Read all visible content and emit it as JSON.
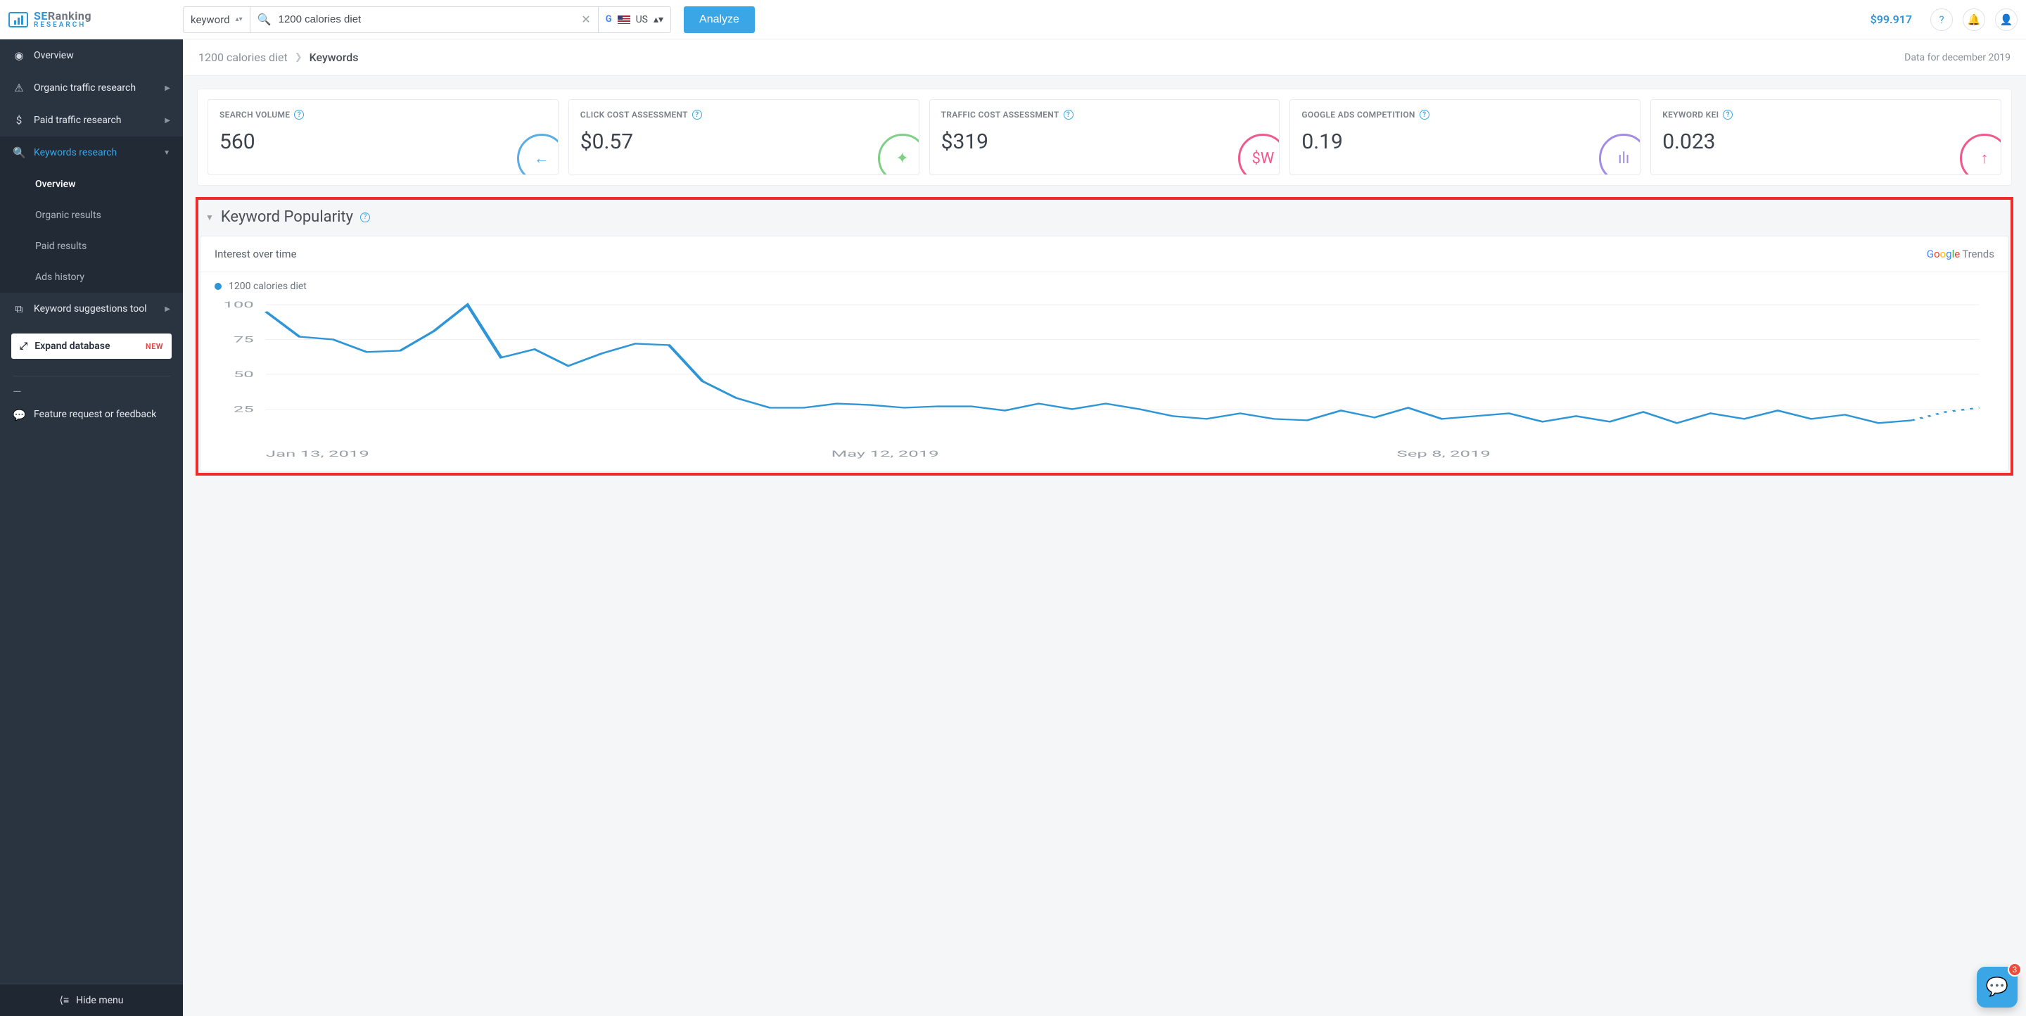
{
  "header": {
    "brand_se": "SE",
    "brand_ranking": "Ranking",
    "brand_sub": "RESEARCH",
    "mode_select": "keyword",
    "search_value": "1200 calories diet",
    "country_code": "US",
    "analyze_btn": "Analyze",
    "balance": "$99.917"
  },
  "sidebar": {
    "items": [
      {
        "icon": "◉",
        "label": "Overview"
      },
      {
        "icon": "⚠",
        "label": "Organic traffic research"
      },
      {
        "icon": "$",
        "label": "Paid traffic research"
      },
      {
        "icon": "🔍",
        "label": "Keywords research"
      },
      {
        "icon": "⧉",
        "label": "Keyword suggestions tool"
      }
    ],
    "sub_items": [
      {
        "label": "Overview"
      },
      {
        "label": "Organic results"
      },
      {
        "label": "Paid results"
      },
      {
        "label": "Ads history"
      }
    ],
    "expand_db": "Expand database",
    "expand_db_badge": "NEW",
    "feedback": "Feature request or feedback",
    "hide_menu": "Hide menu"
  },
  "breadcrumb": {
    "link": "1200 calories diet",
    "current": "Keywords",
    "data_for": "Data for december 2019"
  },
  "metrics": [
    {
      "label": "SEARCH VOLUME",
      "value": "560",
      "color": "#59aee5",
      "glyph": "←"
    },
    {
      "label": "CLICK COST ASSESSMENT",
      "value": "$0.57",
      "color": "#7fcf86",
      "glyph": "✦"
    },
    {
      "label": "TRAFFIC COST ASSESSMENT",
      "value": "$319",
      "color": "#ef5a8b",
      "glyph": "$W"
    },
    {
      "label": "GOOGLE ADS COMPETITION",
      "value": "0.19",
      "color": "#a38be6",
      "glyph": "ılı"
    },
    {
      "label": "KEYWORD KEI",
      "value": "0.023",
      "color": "#ef5a8b",
      "glyph": "↑"
    }
  ],
  "panel": {
    "title": "Keyword Popularity",
    "subtitle": "Interest over time",
    "gtrends_label": "Trends",
    "legend_label": "1200 calories diet",
    "xticks": [
      "Jan 13, 2019",
      "May 12, 2019",
      "Sep 8, 2019"
    ],
    "ytick_labels": [
      "25",
      "50",
      "75",
      "100"
    ]
  },
  "fab": {
    "badge": "3"
  },
  "chart_data": {
    "type": "line",
    "title": "Keyword Popularity — Interest over time",
    "xlabel": "",
    "ylabel": "",
    "ylim": [
      0,
      100
    ],
    "yticks": [
      25,
      50,
      75,
      100
    ],
    "x_dates": [
      "Jan 13, 2019",
      "May 12, 2019",
      "Sep 8, 2019"
    ],
    "series": [
      {
        "name": "1200 calories diet",
        "values": [
          95,
          77,
          75,
          66,
          67,
          81,
          100,
          62,
          68,
          56,
          65,
          72,
          71,
          45,
          33,
          26,
          26,
          29,
          28,
          26,
          27,
          27,
          24,
          29,
          25,
          29,
          25,
          20,
          18,
          22,
          18,
          17,
          24,
          19,
          26,
          18,
          20,
          22,
          16,
          20,
          16,
          23,
          15,
          22,
          18,
          24,
          18,
          21,
          15,
          17,
          23,
          26
        ]
      }
    ],
    "forecast_last_n": 2
  }
}
